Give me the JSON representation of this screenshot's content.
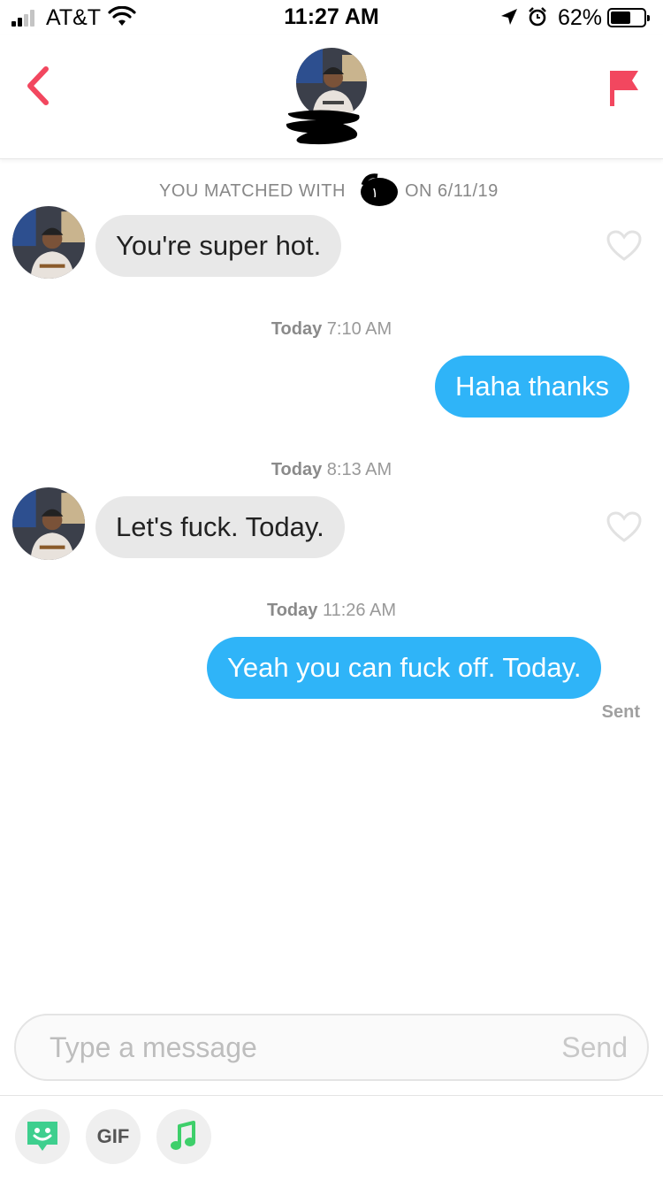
{
  "status_bar": {
    "carrier": "AT&T",
    "time": "11:27 AM",
    "battery_percent": "62%",
    "battery_level": 0.62,
    "signal_bars_filled": 2,
    "signal_bars_total": 4
  },
  "header": {
    "back_icon": "chevron-left-icon",
    "report_icon": "flag-icon",
    "accent_color": "#f2475f"
  },
  "match_banner": {
    "prefix": "YOU MATCHED WITH",
    "suffix": "ON 6/11/19"
  },
  "messages": [
    {
      "direction": "in",
      "text": "You're super hot."
    },
    {
      "timestamp_day": "Today",
      "timestamp_time": "7:10 AM"
    },
    {
      "direction": "out",
      "text": "Haha thanks"
    },
    {
      "timestamp_day": "Today",
      "timestamp_time": "8:13 AM"
    },
    {
      "direction": "in",
      "text": "Let's fuck. Today."
    },
    {
      "timestamp_day": "Today",
      "timestamp_time": "11:26 AM"
    },
    {
      "direction": "out",
      "text": "Yeah you can fuck off. Today.",
      "status": "Sent"
    }
  ],
  "composer": {
    "placeholder": "Type a message",
    "value": "",
    "send_label": "Send"
  },
  "toolbar": {
    "sticker_icon": "sticker-icon",
    "gif_label": "GIF",
    "music_icon": "music-note-icon"
  },
  "colors": {
    "incoming_bubble": "#e8e8e8",
    "outgoing_bubble": "#2fb4f8",
    "sticker_green": "#3ecf8e",
    "music_green": "#3ecf6a"
  }
}
